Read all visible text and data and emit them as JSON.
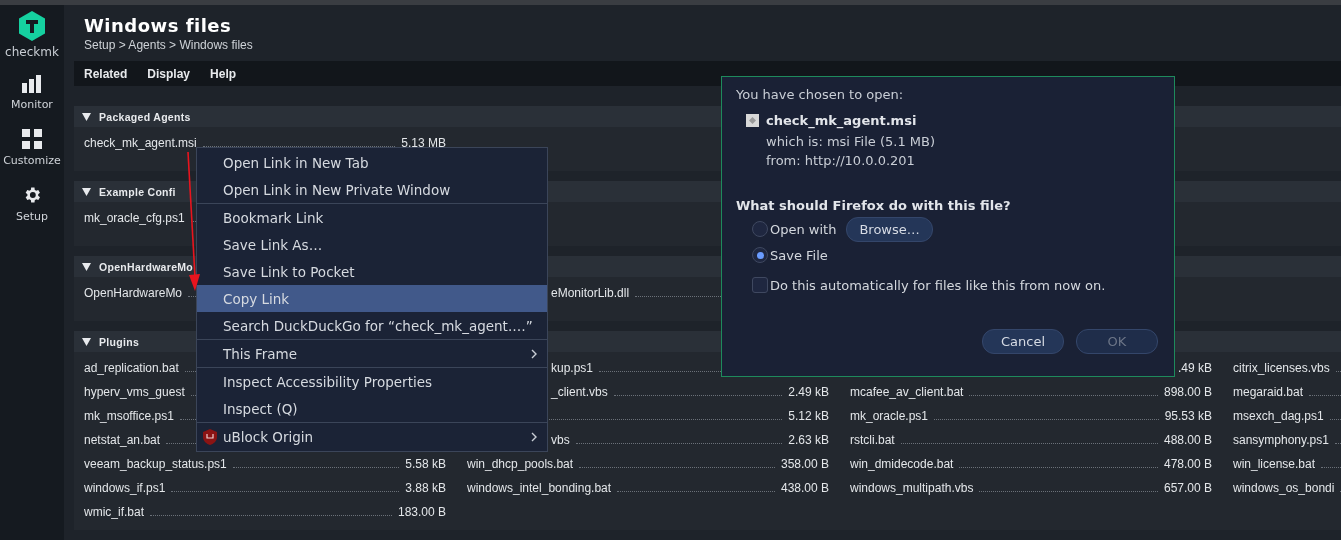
{
  "sidebar": {
    "logo": "checkmk",
    "items": [
      {
        "label": "Monitor",
        "kind": "monitor"
      },
      {
        "label": "Customize",
        "kind": "customize"
      },
      {
        "label": "Setup",
        "kind": "setup"
      }
    ]
  },
  "page": {
    "title": "Windows files",
    "breadcrumb": "Setup > Agents > Windows files"
  },
  "menubar": [
    "Related",
    "Display",
    "Help"
  ],
  "sections": [
    {
      "title": "Packaged Agents",
      "expanded": true,
      "rows": [
        [
          {
            "name": "check_mk_agent.msi",
            "size": "5.13 MB"
          }
        ]
      ]
    },
    {
      "title": "Example Confi",
      "expanded": true,
      "rows": [
        [
          {
            "name": "mk_oracle_cfg.ps1"
          }
        ]
      ]
    },
    {
      "title": "OpenHardwareMo",
      "expanded": true,
      "rows": [
        [
          {
            "name": "OpenHardwareMo"
          },
          {
            "name": "eMonitorLib.dll"
          }
        ]
      ]
    },
    {
      "title": "Plugins",
      "expanded": true,
      "rows": [
        [
          {
            "name": "ad_replication.bat"
          },
          {
            "name": "kup.ps1"
          },
          {
            "size": ".49 kB"
          },
          {
            "name": "citrix_licenses.vbs"
          }
        ],
        [
          {
            "name": "hyperv_vms_guest"
          },
          {
            "name": "_client.vbs",
            "size": "2.49 kB"
          },
          {
            "name": "mcafee_av_client.bat",
            "size": "898.00 B"
          },
          {
            "name": "megaraid.bat"
          }
        ],
        [
          {
            "name": "mk_msoffice.ps1"
          },
          {
            "size": "5.12 kB"
          },
          {
            "name": "mk_oracle.ps1",
            "size": "95.53 kB"
          },
          {
            "name": "msexch_dag.ps1"
          }
        ],
        [
          {
            "name": "netstat_an.bat"
          },
          {
            "name": "vbs",
            "size": "2.63 kB"
          },
          {
            "name": "rstcli.bat",
            "size": "488.00 B"
          },
          {
            "name": "sansymphony.ps1"
          }
        ],
        [
          {
            "name": "veeam_backup_status.ps1",
            "size": "5.58 kB"
          },
          {
            "name": "win_dhcp_pools.bat",
            "size": "358.00 B"
          },
          {
            "name": "win_dmidecode.bat",
            "size": "478.00 B"
          },
          {
            "name": "win_license.bat"
          }
        ],
        [
          {
            "name": "windows_if.ps1",
            "size": "3.88 kB"
          },
          {
            "name": "windows_intel_bonding.bat",
            "size": "438.00 B"
          },
          {
            "name": "windows_multipath.vbs",
            "size": "657.00 B"
          },
          {
            "name": "windows_os_bondi"
          }
        ],
        [
          {
            "name": "wmic_if.bat",
            "size": "183.00 B"
          }
        ]
      ]
    }
  ],
  "context_menu": {
    "items": [
      {
        "kind": "item",
        "label": "Open Link in New Tab",
        "selected": false,
        "submenu": false
      },
      {
        "kind": "item",
        "label": "Open Link in New Private Window",
        "selected": false,
        "submenu": false
      },
      {
        "kind": "separator"
      },
      {
        "kind": "item",
        "label": "Bookmark Link",
        "selected": false,
        "submenu": false
      },
      {
        "kind": "item",
        "label": "Save Link As…",
        "selected": false,
        "submenu": false
      },
      {
        "kind": "item",
        "label": "Save Link to Pocket",
        "selected": false,
        "submenu": false
      },
      {
        "kind": "item",
        "label": "Copy Link",
        "selected": true,
        "submenu": false
      },
      {
        "kind": "item",
        "label": "Search DuckDuckGo for “check_mk_agent.…”",
        "selected": false,
        "submenu": false
      },
      {
        "kind": "separator"
      },
      {
        "kind": "item",
        "label": "This Frame",
        "selected": false,
        "submenu": true
      },
      {
        "kind": "separator"
      },
      {
        "kind": "item",
        "label": "Inspect Accessibility Properties",
        "selected": false,
        "submenu": false
      },
      {
        "kind": "item",
        "label": "Inspect (Q)",
        "selected": false,
        "submenu": false
      },
      {
        "kind": "separator"
      },
      {
        "kind": "extension",
        "label": "uBlock Origin",
        "selected": false,
        "submenu": true
      }
    ]
  },
  "dialog": {
    "heading": "You have chosen to open:",
    "file_name": "check_mk_agent.msi",
    "file_type": "which is: msi File (5.1 MB)",
    "source": "from: http://10.0.0.201",
    "question": "What should Firefox do with this file?",
    "options": [
      {
        "label": "Open with",
        "selected": false,
        "button": "Browse…"
      },
      {
        "label": "Save File",
        "selected": true
      }
    ],
    "remember": {
      "label": "Do this automatically for files like this from now on.",
      "checked": false
    },
    "buttons": [
      {
        "label": "Cancel",
        "disabled": false
      },
      {
        "label": "OK",
        "disabled": true
      }
    ]
  }
}
